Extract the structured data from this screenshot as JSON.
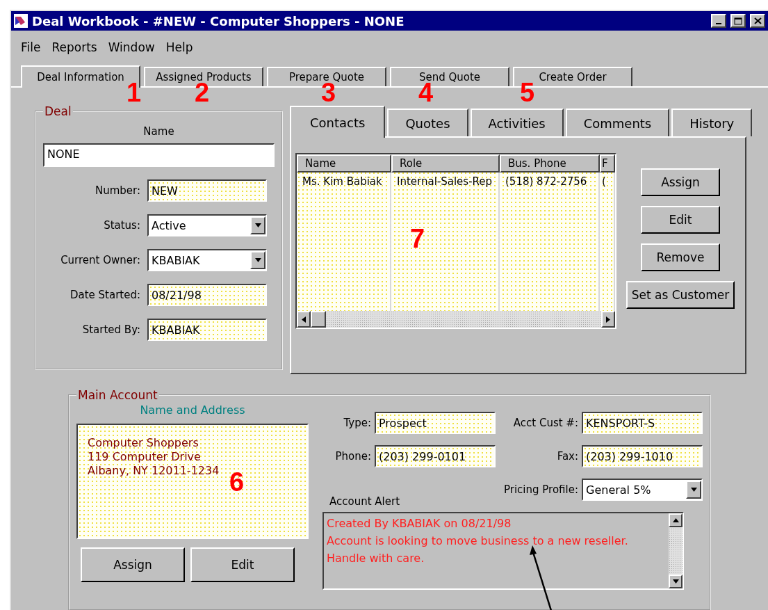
{
  "window": {
    "title": "Deal Workbook - #NEW - Computer Shoppers - NONE"
  },
  "menu": [
    "File",
    "Reports",
    "Window",
    "Help"
  ],
  "tabs": [
    {
      "label": "Deal Information",
      "selected": true
    },
    {
      "label": "Assigned Products",
      "selected": false
    },
    {
      "label": "Prepare Quote",
      "selected": false
    },
    {
      "label": "Send Quote",
      "selected": false
    },
    {
      "label": "Create Order",
      "selected": false
    }
  ],
  "deal": {
    "title": "Deal",
    "name_label": "Name",
    "name_value": "NONE",
    "fields": [
      {
        "label": "Number:",
        "value": "NEW",
        "kind": "text"
      },
      {
        "label": "Status:",
        "value": "Active",
        "kind": "dropdown"
      },
      {
        "label": "Current Owner:",
        "value": "KBABIAK",
        "kind": "dropdown"
      },
      {
        "label": "Date Started:",
        "value": "08/21/98",
        "kind": "text"
      },
      {
        "label": "Started By:",
        "value": "KBABIAK",
        "kind": "text"
      }
    ]
  },
  "detail_tabs": [
    {
      "label": "Contacts",
      "selected": true
    },
    {
      "label": "Quotes",
      "selected": false
    },
    {
      "label": "Activities",
      "selected": false
    },
    {
      "label": "Comments",
      "selected": false
    },
    {
      "label": "History",
      "selected": false
    }
  ],
  "contacts_table": {
    "columns": [
      "Name",
      "Role",
      "Bus. Phone",
      "F"
    ],
    "rows": [
      [
        "Ms. Kim Babiak",
        "Internal-Sales-Rep",
        "(518) 872-2756",
        "("
      ]
    ]
  },
  "contact_buttons": [
    "Assign",
    "Edit",
    "Remove",
    "Set as Customer"
  ],
  "main_account": {
    "title": "Main Account",
    "address_label": "Name and Address",
    "address_lines": [
      "Computer Shoppers",
      "119 Computer Drive",
      "Albany, NY 12011-1234"
    ],
    "buttons": [
      "Assign",
      "Edit"
    ],
    "fields": [
      {
        "label": "Type:",
        "value": "Prospect",
        "kind": "text"
      },
      {
        "label": "Acct Cust #:",
        "value": "KENSPORT-S",
        "kind": "text"
      },
      {
        "label": "Phone:",
        "value": "(203) 299-0101",
        "kind": "text"
      },
      {
        "label": "Fax:",
        "value": "(203) 299-1010",
        "kind": "text"
      },
      {
        "label": "Pricing Profile:",
        "value": "General 5%",
        "kind": "dropdown"
      }
    ],
    "alert_label": "Account Alert",
    "alert_lines": [
      "Created By KBABIAK on 08/21/98",
      "Account is looking to move business to a new reseller.",
      "Handle with care."
    ]
  },
  "callouts": [
    "1",
    "2",
    "3",
    "4",
    "5",
    "6",
    "7"
  ]
}
